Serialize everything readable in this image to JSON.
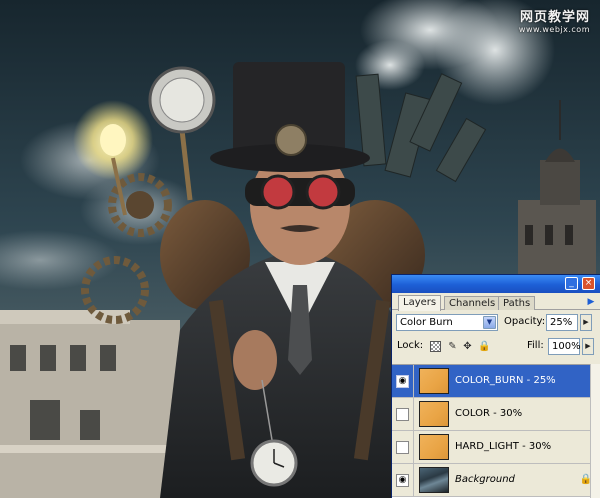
{
  "watermark": {
    "site_name": "网页教学网",
    "url": "www.webjx.com"
  },
  "layers_panel": {
    "title_buttons": {
      "minimize": "_",
      "close": "×"
    },
    "tabs": [
      {
        "label": "Layers",
        "active": true
      },
      {
        "label": "Channels",
        "active": false
      },
      {
        "label": "Paths",
        "active": false
      }
    ],
    "tab_menu_icon": "flyout-menu-icon",
    "blend_mode": "Color Burn",
    "opacity_label": "Opacity:",
    "opacity_value": "25%",
    "lock_label": "Lock:",
    "fill_label": "Fill:",
    "fill_value": "100%",
    "lock_icons": [
      "lock-transparent-icon",
      "lock-paint-icon",
      "lock-move-icon",
      "lock-all-icon"
    ],
    "layers": [
      {
        "name": "COLOR_BURN - 25%",
        "visible": true,
        "selected": true,
        "thumbnail": "orange-fill",
        "locked": false
      },
      {
        "name": "COLOR - 30%",
        "visible": false,
        "selected": false,
        "thumbnail": "orange-fill",
        "locked": false
      },
      {
        "name": "HARD_LIGHT - 30%",
        "visible": false,
        "selected": false,
        "thumbnail": "orange-fill",
        "locked": false
      },
      {
        "name": "Background",
        "visible": true,
        "selected": false,
        "thumbnail": "photo",
        "locked": true
      }
    ]
  },
  "colors": {
    "panel_bg": "#ece9d8",
    "titlebar_blue": "#1d5fd6",
    "selected_layer": "#3163c5",
    "layer_fill_orange": "#e9a445"
  }
}
